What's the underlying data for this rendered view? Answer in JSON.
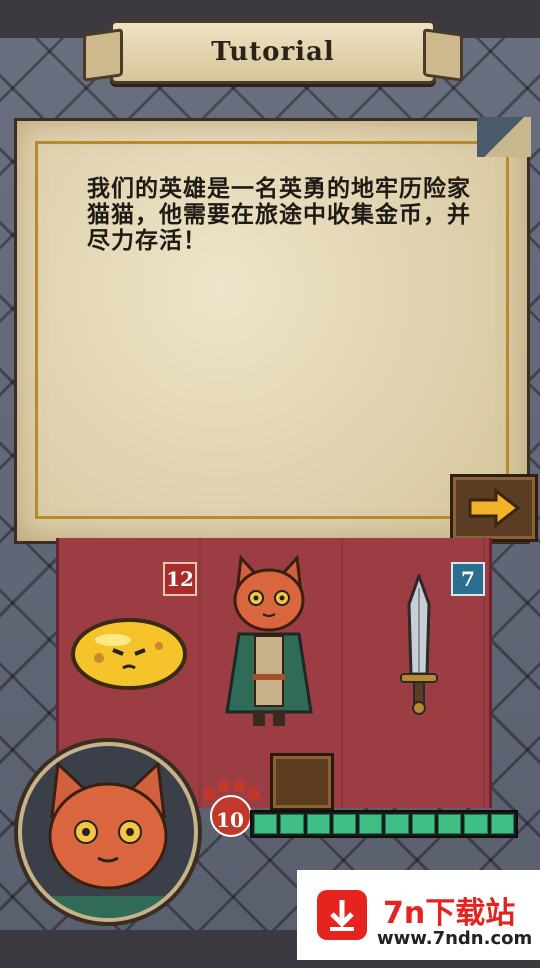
{
  "header": {
    "title": "Tutorial"
  },
  "dialog": {
    "text": "我们的英雄是一名英勇的地牢历险家猫猫，他需要在旅途中收集金币，并尽力存活！",
    "next_icon": "arrow-right-icon"
  },
  "board": {
    "enemy_value": "12",
    "weapon_value": "7",
    "enemy_icon": "yellow-slime-icon",
    "hero_icon": "cat-hero-icon",
    "weapon_icon": "dagger-icon"
  },
  "player": {
    "health": "10",
    "health_segments": 10,
    "health_icon": "paw-icon"
  },
  "watermark": {
    "title": "7n下载站",
    "url": "www.7ndn.com"
  },
  "colors": {
    "accent": "#b8892e",
    "health": "#3fbf86",
    "board": "#9c3d44"
  }
}
